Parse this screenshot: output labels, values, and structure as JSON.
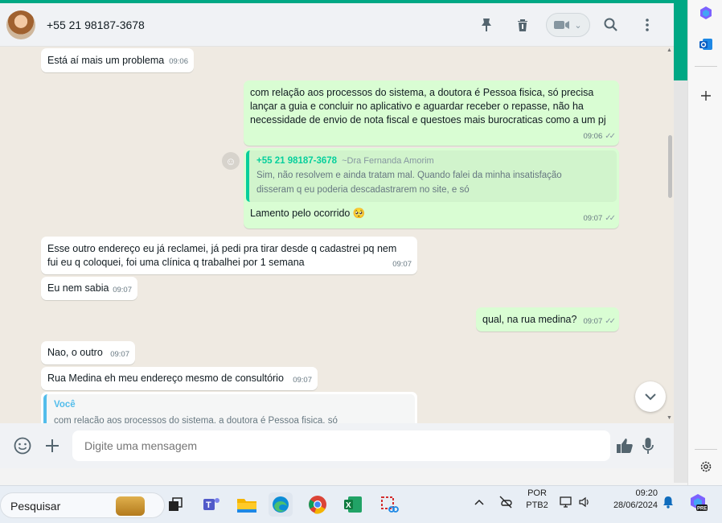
{
  "header": {
    "contact_name": "+55 21 98187-3678",
    "icons": [
      "pin-icon",
      "trash-icon",
      "video-call-icon",
      "search-icon",
      "menu-icon"
    ]
  },
  "messages": [
    {
      "dir": "in",
      "text": "Está aí mais um problema",
      "time": "09:06"
    },
    {
      "dir": "out",
      "text": "com relação aos processos do sistema, a doutora é Pessoa fisica, só precisa lançar a guia e concluir no aplicativo e aguardar receber o repasse, não ha necessidade de envio de nota fiscal e questoes mais burocraticas como a um pj",
      "time": "09:06",
      "ticks": "✓✓"
    },
    {
      "dir": "out",
      "quote_author": "+55 21 98187-3678",
      "quote_pushname": "~Dra Fernanda Amorim",
      "quote_text": "Sim, não resolvem e ainda tratam mal. Quando falei da minha insatisfação disseram q eu poderia descadastrarem no site, e só",
      "text": "Lamento pelo ocorrido 🥺",
      "time": "09:07",
      "ticks": "✓✓"
    },
    {
      "dir": "in",
      "text": "Esse outro endereço eu já reclamei, já pedi pra tirar desde q cadastrei pq nem fui eu q coloquei, foi uma clínica q trabalhei por 1 semana",
      "time": "09:07"
    },
    {
      "dir": "in",
      "text": "Eu nem sabia",
      "time": "09:07"
    },
    {
      "dir": "out",
      "text": "qual, na rua medina?",
      "time": "09:07",
      "ticks": "✓✓"
    },
    {
      "dir": "in",
      "text": "Nao, o outro",
      "time": "09:07"
    },
    {
      "dir": "in",
      "text": "Rua Medina eh meu endereço mesmo de consultório",
      "time": "09:07"
    },
    {
      "dir": "in",
      "quote_author": "Você",
      "quote_text": "com relação aos processos do sistema, a doutora é Pessoa fisica, só"
    }
  ],
  "composer": {
    "placeholder": "Digite uma mensagem"
  },
  "taskbar": {
    "search_label": "Pesquisar",
    "lang_top": "POR",
    "lang_bottom": "PTB2",
    "clock_time": "09:20",
    "clock_date": "28/06/2024",
    "copilot_badge": "PRE"
  },
  "colors": {
    "accent": "#00a884",
    "outgoing": "#d9fdd3",
    "incoming": "#ffffff",
    "chat_bg": "#efeae2"
  }
}
